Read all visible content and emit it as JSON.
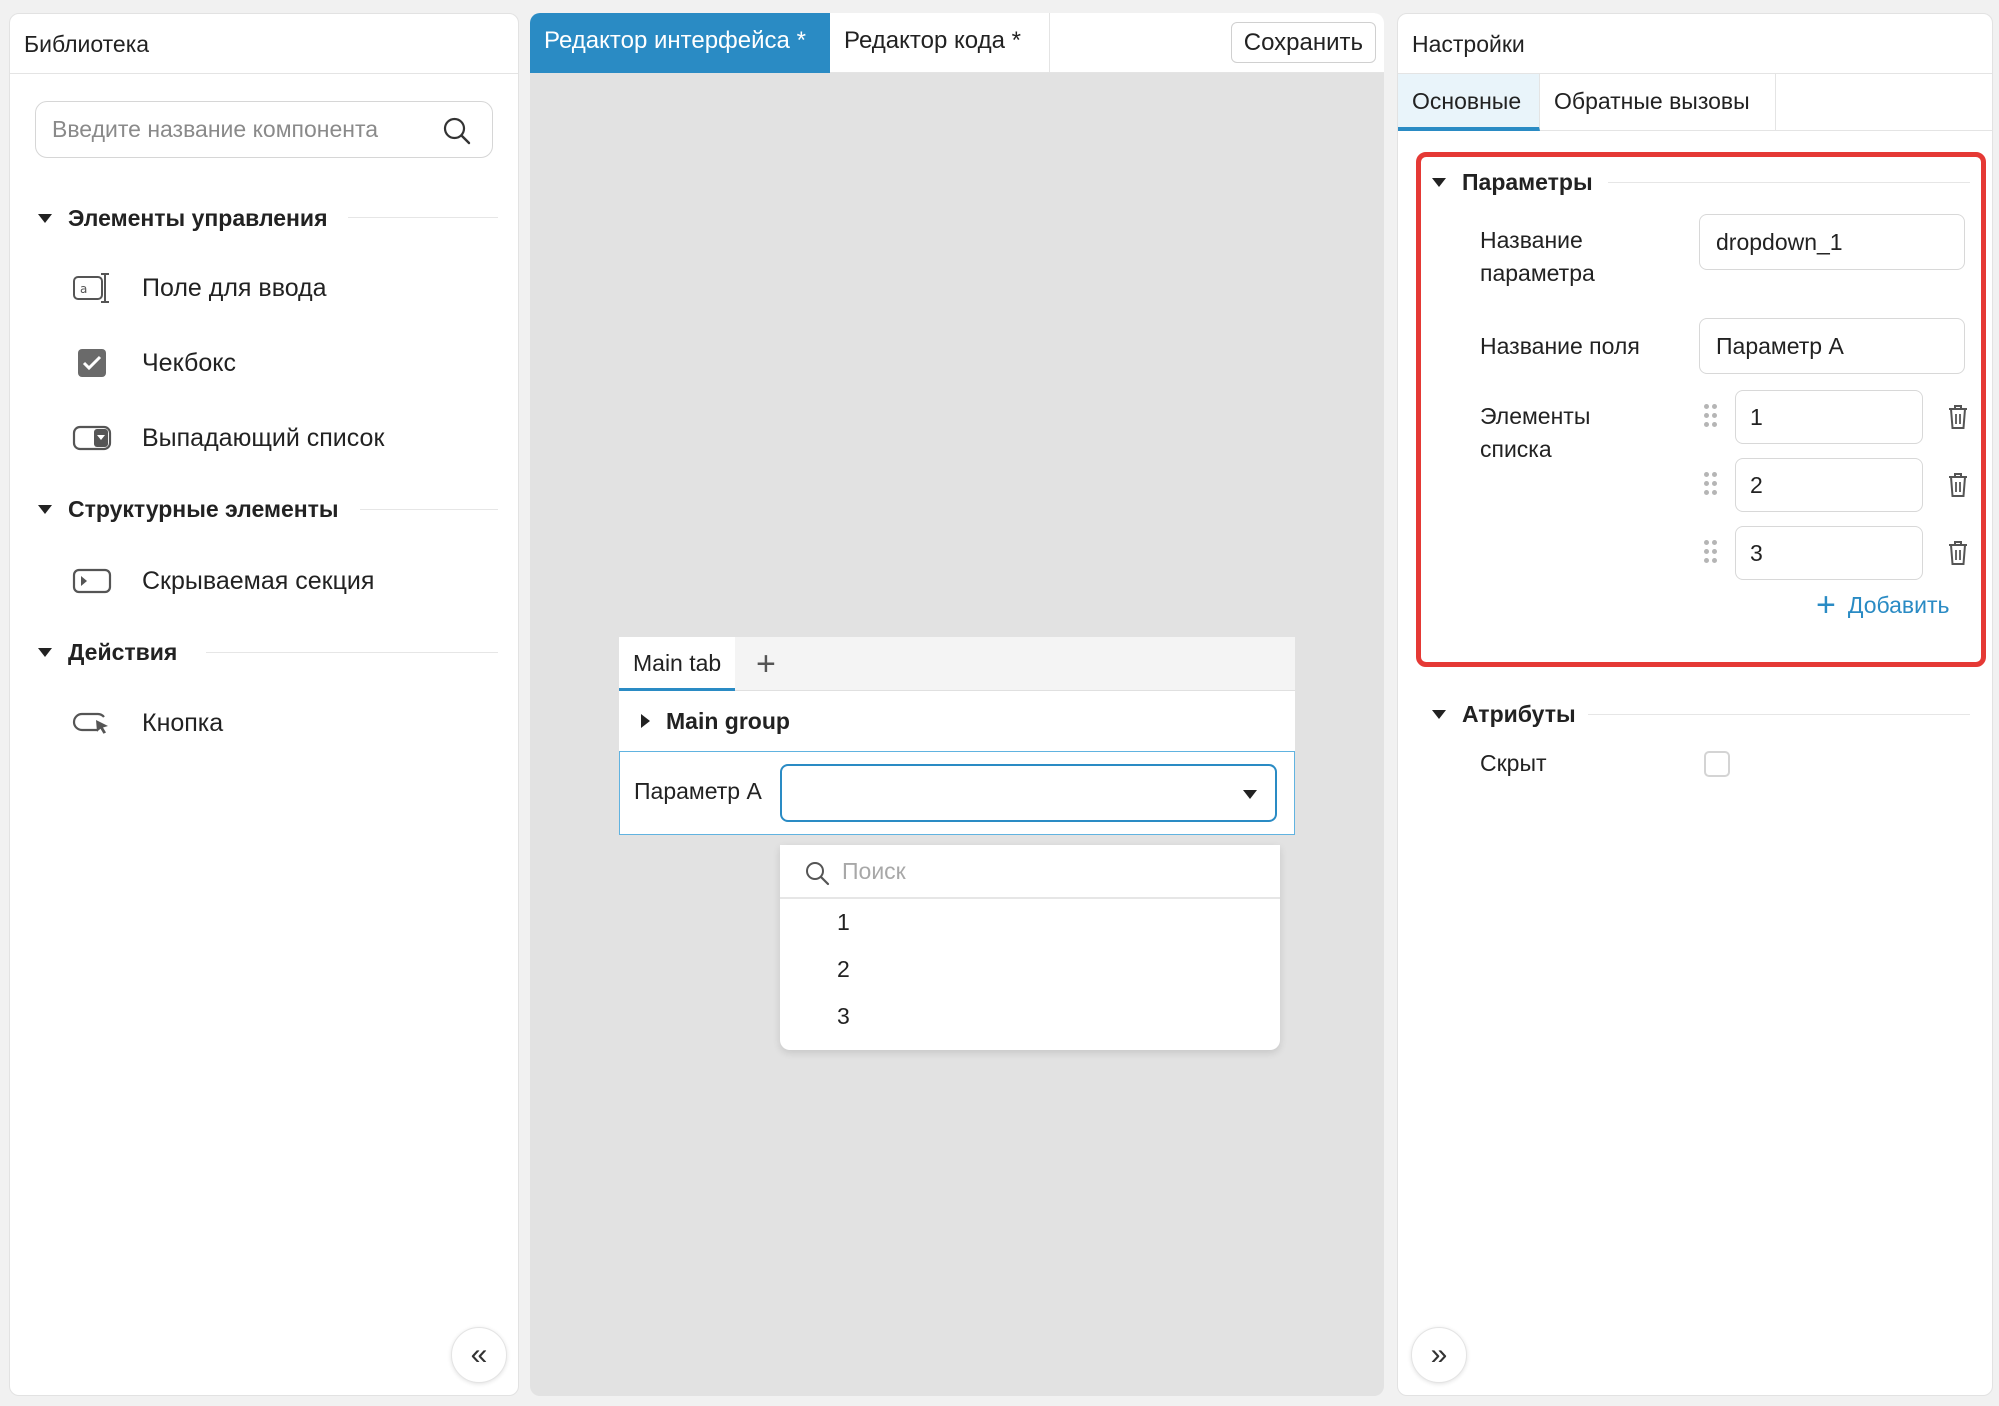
{
  "library": {
    "title": "Библиотека",
    "search_placeholder": "Введите название компонента",
    "groups": [
      {
        "label": "Элементы управления",
        "items": [
          "Поле для ввода",
          "Чекбокс",
          "Выпадающий список"
        ]
      },
      {
        "label": "Структурные элементы",
        "items": [
          "Скрываемая секция"
        ]
      },
      {
        "label": "Действия",
        "items": [
          "Кнопка"
        ]
      }
    ],
    "collapse_label": "«"
  },
  "editor": {
    "tabs": [
      {
        "label": "Редактор интерфейса  *",
        "active": true
      },
      {
        "label": "Редактор кода  *",
        "active": false
      }
    ],
    "save_label": "Сохранить",
    "form": {
      "tab_label": "Main tab",
      "add_tab_label": "+",
      "group_label": "Main group",
      "param_label": "Параметр А",
      "dropdown_value": "",
      "dropdown_search_placeholder": "Поиск",
      "dropdown_options": [
        "1",
        "2",
        "3"
      ]
    }
  },
  "settings": {
    "title": "Настройки",
    "tabs": [
      {
        "label": "Основные",
        "active": true
      },
      {
        "label": "Обратные вызовы",
        "active": false
      }
    ],
    "params_section": "Параметры",
    "param_name_label": "Название параметра",
    "param_name_value": "dropdown_1",
    "field_name_label": "Название поля",
    "field_name_value": "Параметр А",
    "list_items_label": "Элементы списка",
    "list_items": [
      "1",
      "2",
      "3"
    ],
    "add_label": "Добавить",
    "attrs_section": "Атрибуты",
    "hidden_label": "Скрыт",
    "hidden_checked": false,
    "expand_label": "»"
  },
  "colors": {
    "accent": "#2a8bc4",
    "highlight": "#e53935",
    "canvas": "#e2e2e2"
  }
}
